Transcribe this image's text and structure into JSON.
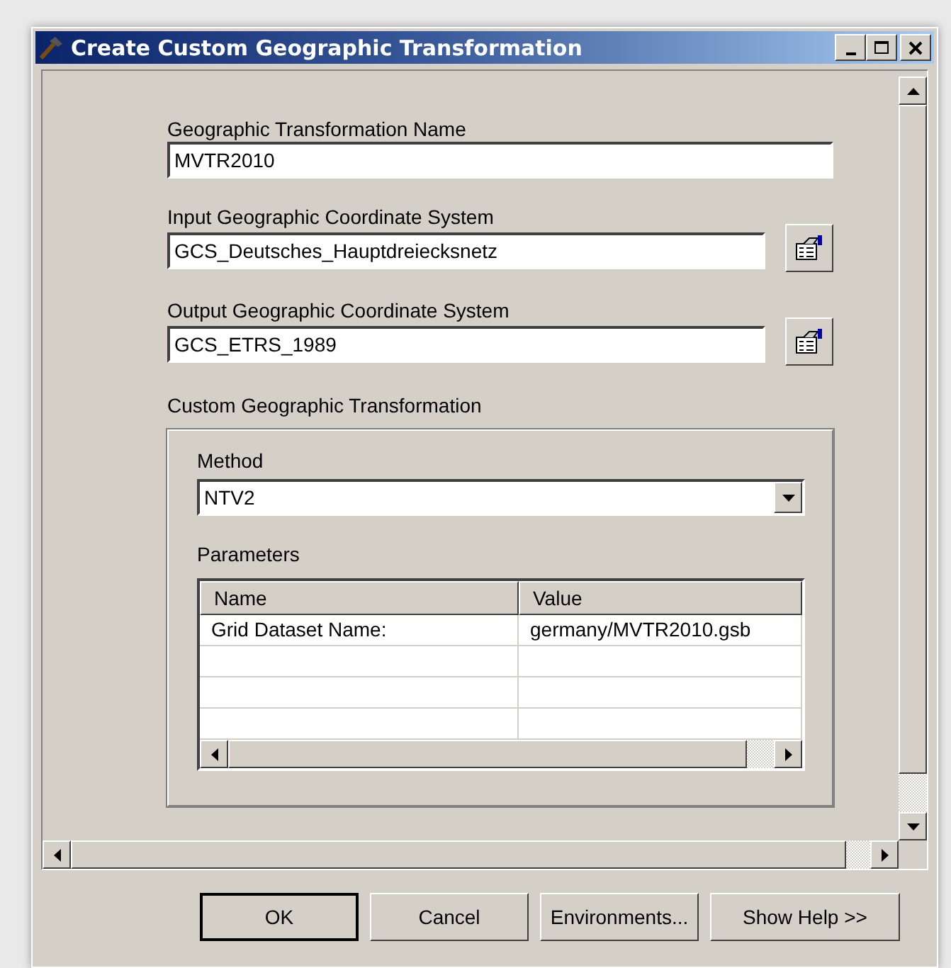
{
  "window": {
    "title": "Create Custom Geographic Transformation"
  },
  "fields": [
    {
      "kind": "text",
      "label": "Geographic Transformation Name",
      "value": "MVTR2010"
    },
    {
      "kind": "browse",
      "label": "Input Geographic Coordinate System",
      "value": "GCS_Deutsches_Hauptdreiecksnetz"
    },
    {
      "kind": "browse",
      "label": "Output Geographic Coordinate System",
      "value": "GCS_ETRS_1989"
    }
  ],
  "group": {
    "label": "Custom Geographic Transformation",
    "method": {
      "label": "Method",
      "value": "NTV2"
    },
    "parameters": {
      "label": "Parameters",
      "columns": [
        "Name",
        "Value"
      ],
      "rows": [
        {
          "name": "Grid Dataset Name:",
          "value": "germany/MVTR2010.gsb"
        }
      ]
    }
  },
  "buttons": [
    {
      "label": "OK",
      "default": true
    },
    {
      "label": "Cancel",
      "default": false
    },
    {
      "label": "Environments...",
      "default": false
    },
    {
      "label": "Show Help >>",
      "default": false
    }
  ]
}
